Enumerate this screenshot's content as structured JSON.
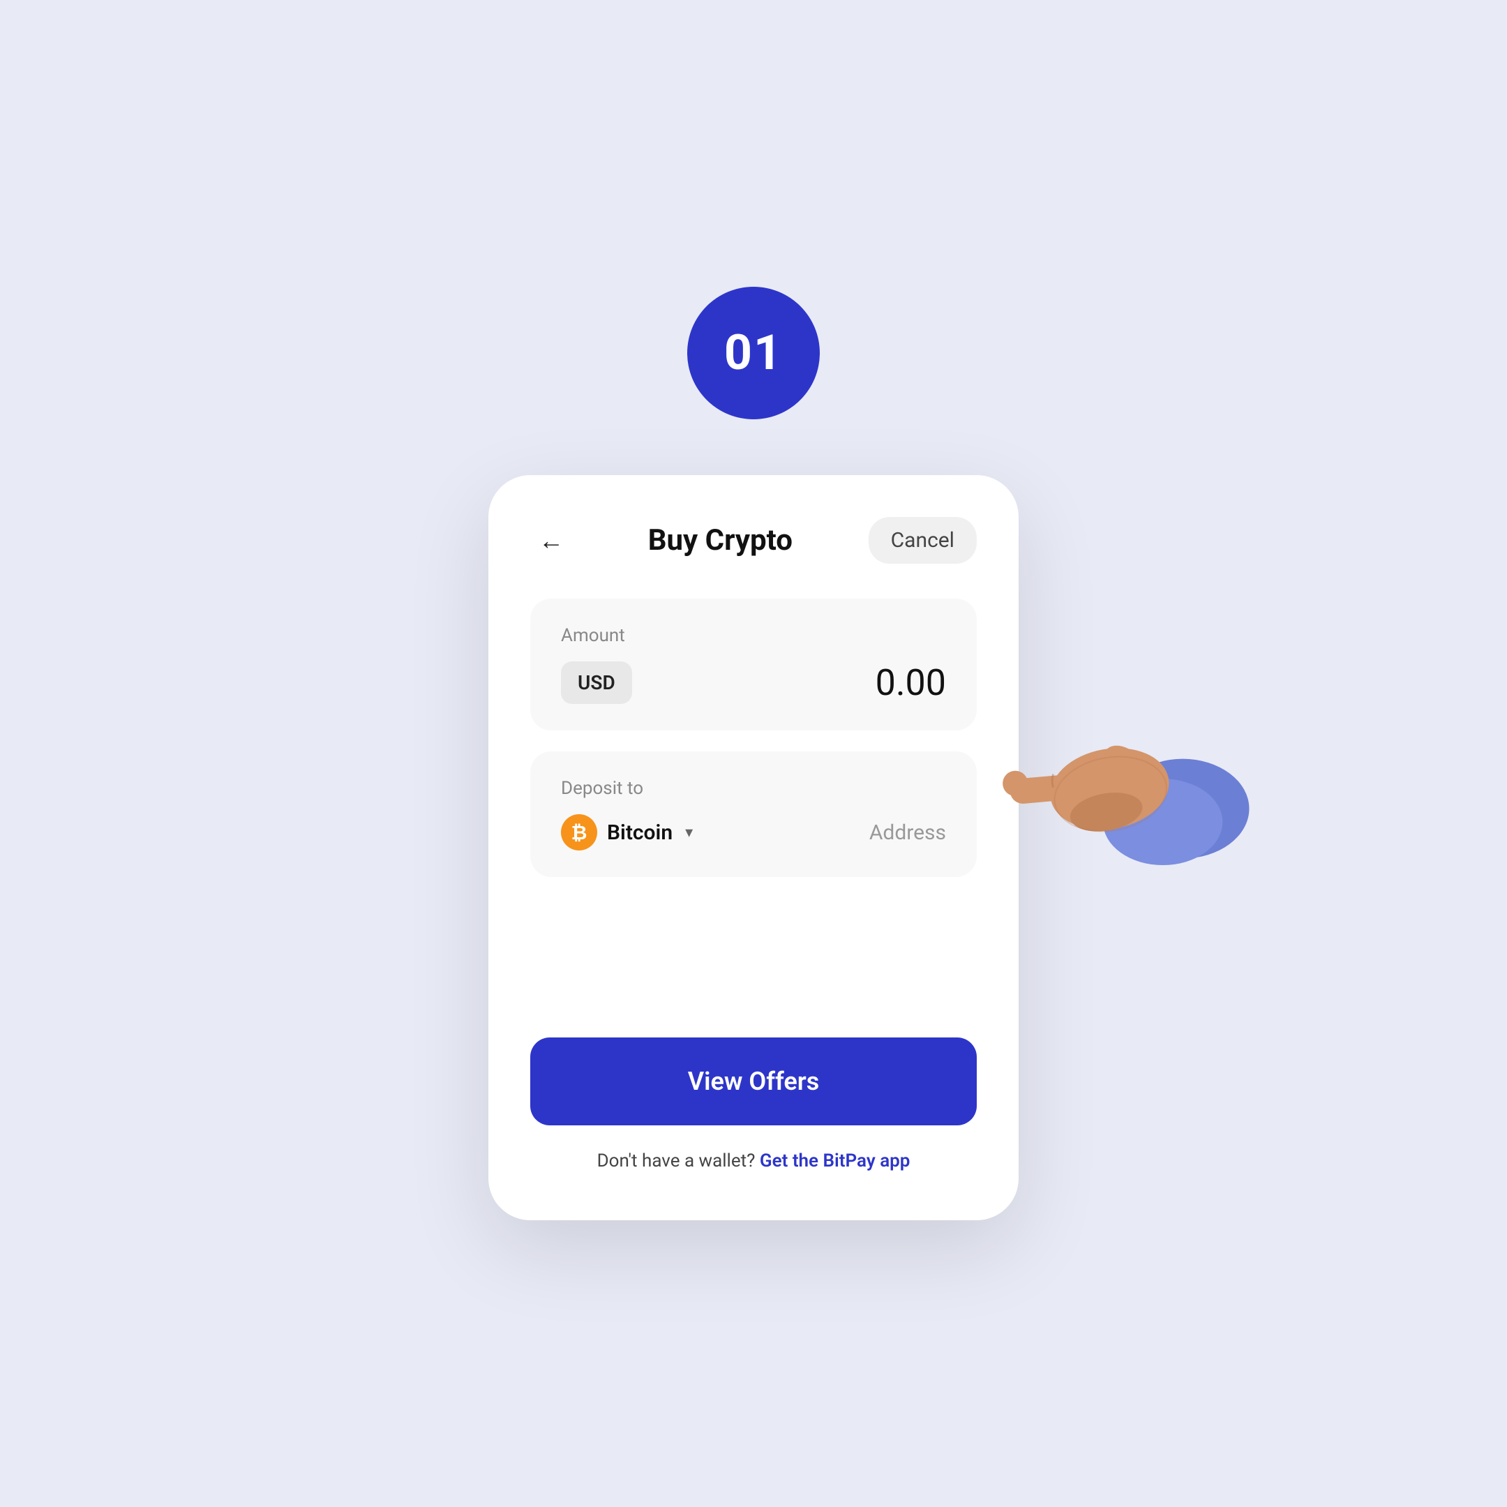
{
  "page": {
    "background_color": "#e8eaf6"
  },
  "step_badge": {
    "number": "01",
    "bg_color": "#2d35c9"
  },
  "header": {
    "title": "Buy Crypto",
    "cancel_label": "Cancel"
  },
  "amount_section": {
    "label": "Amount",
    "currency": "USD",
    "value": "0.00"
  },
  "deposit_section": {
    "label": "Deposit to",
    "crypto_name": "Bitcoin",
    "address_placeholder": "Address"
  },
  "actions": {
    "view_offers_label": "View Offers",
    "wallet_prompt": "Don't have a wallet?",
    "wallet_link": "Get the BitPay app"
  }
}
